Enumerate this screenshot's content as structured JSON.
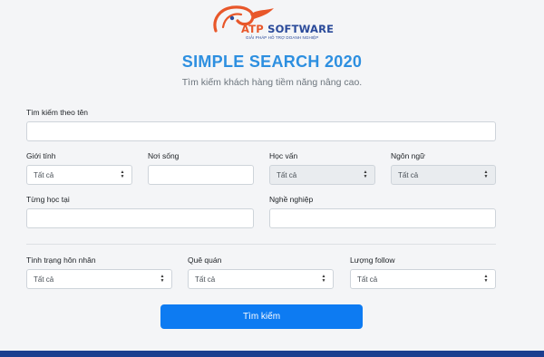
{
  "logo": {
    "brand_a": "ATP",
    "brand_b": " SOFTWARE",
    "tagline": "GIẢI PHÁP HỖ TRỢ DOANH NGHIỆP"
  },
  "header": {
    "title": "SIMPLE SEARCH 2020",
    "subtitle": "Tìm kiếm khách hàng tiềm năng nâng cao."
  },
  "form": {
    "name_label": "Tìm kiếm theo tên",
    "name_value": "",
    "gender": {
      "label": "Giới tính",
      "value": "Tất cả"
    },
    "residence": {
      "label": "Nơi sống",
      "value": ""
    },
    "education": {
      "label": "Học vấn",
      "value": "Tất cả"
    },
    "language": {
      "label": "Ngôn ngữ",
      "value": "Tất cả"
    },
    "studied_at": {
      "label": "Từng học tại",
      "value": ""
    },
    "occupation": {
      "label": "Nghề nghiệp",
      "value": ""
    },
    "marital": {
      "label": "Tình trạng hôn nhân",
      "value": "Tất cả"
    },
    "hometown": {
      "label": "Quê quán",
      "value": "Tất cả"
    },
    "followers": {
      "label": "Lượng follow",
      "value": "Tất cả"
    },
    "submit_label": "Tìm kiếm"
  },
  "icons": {
    "select_caret": "up-down-caret-icon",
    "logo": "atp-logo-icon"
  },
  "colors": {
    "title": "#2d8fe0",
    "button": "#0d7bf2",
    "logo_orange": "#e8572a",
    "logo_blue": "#2a4a9a",
    "footer": "#1b3f8f"
  }
}
